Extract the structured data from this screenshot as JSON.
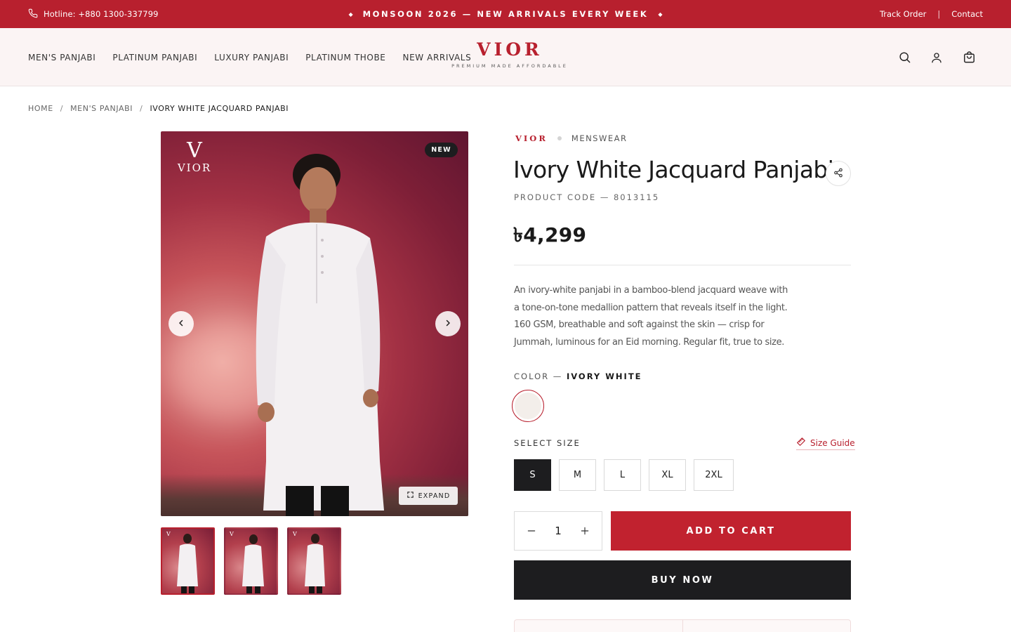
{
  "topbar": {
    "hotline": "Hotline: +880 1300-337799",
    "announcement": "MONSOON 2026 — NEW ARRIVALS EVERY WEEK",
    "track_order": "Track Order",
    "separator": "|",
    "contact": "Contact"
  },
  "nav": {
    "items": [
      "MEN'S PANJABI",
      "PLATINUM PANJABI",
      "LUXURY PANJABI",
      "PLATINUM THOBE",
      "NEW ARRIVALS"
    ]
  },
  "logo": {
    "wordmark": "VIOR",
    "tagline": "PREMIUM MADE AFFORDABLE"
  },
  "header_icons": [
    "search-icon",
    "account-icon",
    "cart-icon"
  ],
  "breadcrumb": {
    "items": [
      "HOME",
      "MEN'S PANJABI",
      "IVORY WHITE JACQUARD PANJABI"
    ],
    "separator": "/"
  },
  "gallery": {
    "image_logo_mark": "V",
    "image_logo_name": "VIOR",
    "badge": "NEW",
    "expand_label": "EXPAND",
    "thumb_count": 3,
    "active_thumb": 0
  },
  "product": {
    "brand": "VIOR",
    "category": "MENSWEAR",
    "title": "Ivory White Jacquard Panjabi",
    "code_label": "PRODUCT CODE — 8013115",
    "price": "৳4,299",
    "description": "An ivory-white panjabi in a bamboo-blend jacquard weave with a tone-on-tone medallion pattern that reveals itself in the light. 160 GSM, breathable and soft against the skin — crisp for Jummah, luminous for an Eid morning. Regular fit, true to size.",
    "color_label": "COLOR —",
    "color_value": "IVORY WHITE",
    "color_swatch": "#f3eeea",
    "size_label": "SELECT SIZE",
    "size_guide": "Size Guide",
    "sizes": [
      "S",
      "M",
      "L",
      "XL",
      "2XL"
    ],
    "selected_size": "S",
    "quantity": "1",
    "add_to_cart": "ADD TO CART",
    "buy_now": "BUY NOW"
  },
  "colors": {
    "brand_red": "#b8202e",
    "dark": "#1d1d1f",
    "header_bg": "#fbf4f4"
  }
}
